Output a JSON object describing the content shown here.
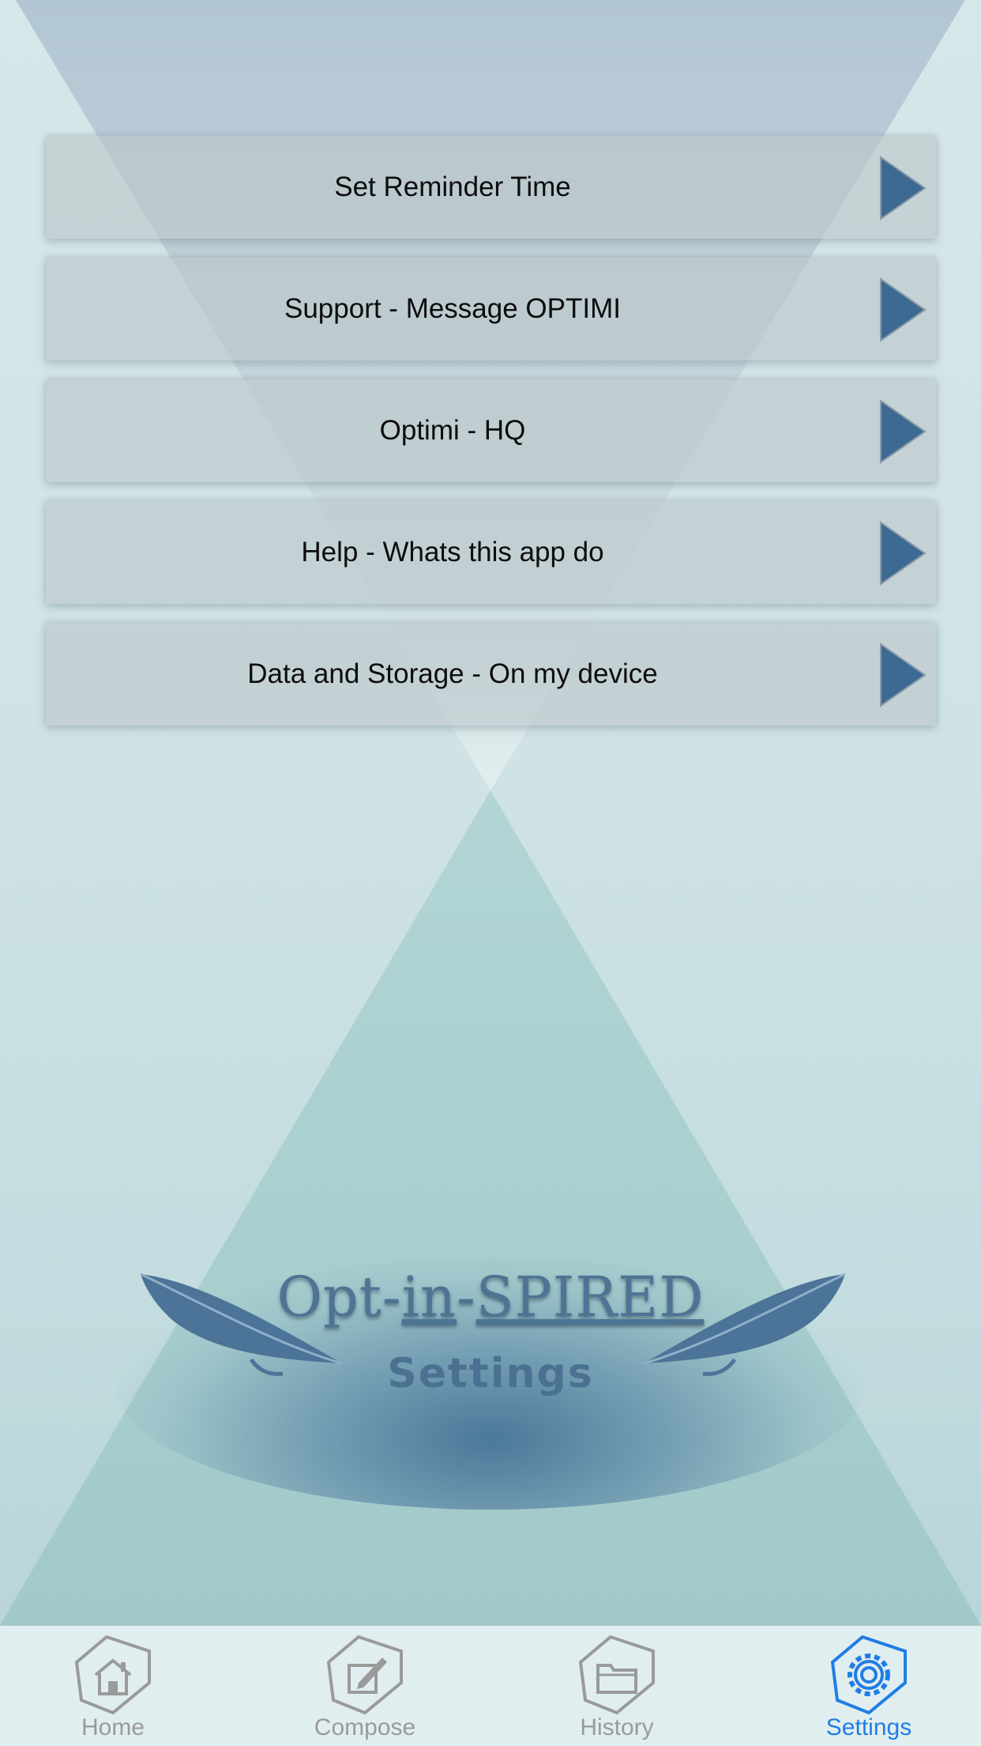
{
  "menu": {
    "items": [
      {
        "label": "Set Reminder Time",
        "icon": "play-arrow-icon"
      },
      {
        "label": "Support - Message OPTIMI",
        "icon": "play-arrow-icon"
      },
      {
        "label": "Optimi - HQ",
        "icon": "play-arrow-icon"
      },
      {
        "label": "Help - Whats this app do",
        "icon": "play-arrow-icon"
      },
      {
        "label": "Data and Storage - On my device",
        "icon": "play-arrow-icon"
      }
    ]
  },
  "brand": {
    "title_part1": "Opt-",
    "title_part2": "in",
    "title_part3": "-",
    "title_part4": "SPIRED",
    "subtitle": "Settings"
  },
  "tabbar": {
    "tabs": [
      {
        "label": "Home",
        "icon": "home-icon",
        "active": false
      },
      {
        "label": "Compose",
        "icon": "compose-icon",
        "active": false
      },
      {
        "label": "History",
        "icon": "folder-icon",
        "active": false
      },
      {
        "label": "Settings",
        "icon": "gear-icon",
        "active": true
      }
    ]
  },
  "colors": {
    "accent": "#1f7ee6",
    "arrow": "#3d6a93",
    "inactive_tab": "#9a9a9a",
    "brand": "#4d7493"
  }
}
